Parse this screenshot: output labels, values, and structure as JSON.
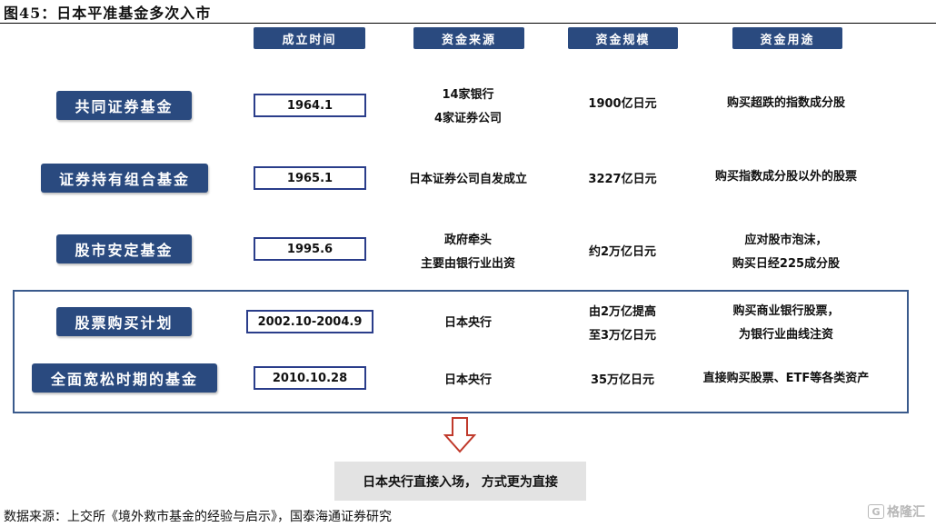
{
  "figure": {
    "title": "图45：日本平准基金多次入市",
    "source": "数据来源：上交所《境外救市基金的经验与启示》，国泰海通证券研究"
  },
  "headers": [
    "成立时间",
    "资金来源",
    "资金规模",
    "资金用途"
  ],
  "rows": [
    {
      "name": "共同证券基金",
      "date": "1964.1",
      "source": [
        "14家银行",
        "4家证券公司"
      ],
      "scale": [
        "1900亿日元"
      ],
      "use": [
        "购买超跌的指数成分股"
      ]
    },
    {
      "name": "证券持有组合基金",
      "date": "1965.1",
      "source": [
        "日本证券公司自发成立"
      ],
      "scale": [
        "3227亿日元"
      ],
      "use": [
        "购买指数成分股以外的股票"
      ]
    },
    {
      "name": "股市安定基金",
      "date": "1995.6",
      "source": [
        "政府牵头",
        "主要由银行业出资"
      ],
      "scale": [
        "约2万亿日元"
      ],
      "use": [
        "应对股市泡沫，",
        "购买日经225成分股"
      ]
    },
    {
      "name": "股票购买计划",
      "date": "2002.10-2004.9",
      "source": [
        "日本央行"
      ],
      "scale": [
        "由2万亿提高",
        "至3万亿日元"
      ],
      "use": [
        "购买商业银行股票，",
        "为银行业曲线注资"
      ]
    },
    {
      "name": "全面宽松时期的基金",
      "date": "2010.10.28",
      "source": [
        "日本央行"
      ],
      "scale": [
        "35万亿日元"
      ],
      "use": [
        "直接购买股票、ETF等各类资产"
      ]
    }
  ],
  "conclusion": "日本央行直接入场， 方式更为直接",
  "watermark": "格隆汇",
  "watermark_mark": "G",
  "colors": {
    "navy": "#2a4a7f",
    "date_border": "#2a3d8a",
    "frame_border": "#3a5a8c",
    "arrow": "#c0392b",
    "conclusion_bg": "#e3e3e3"
  }
}
